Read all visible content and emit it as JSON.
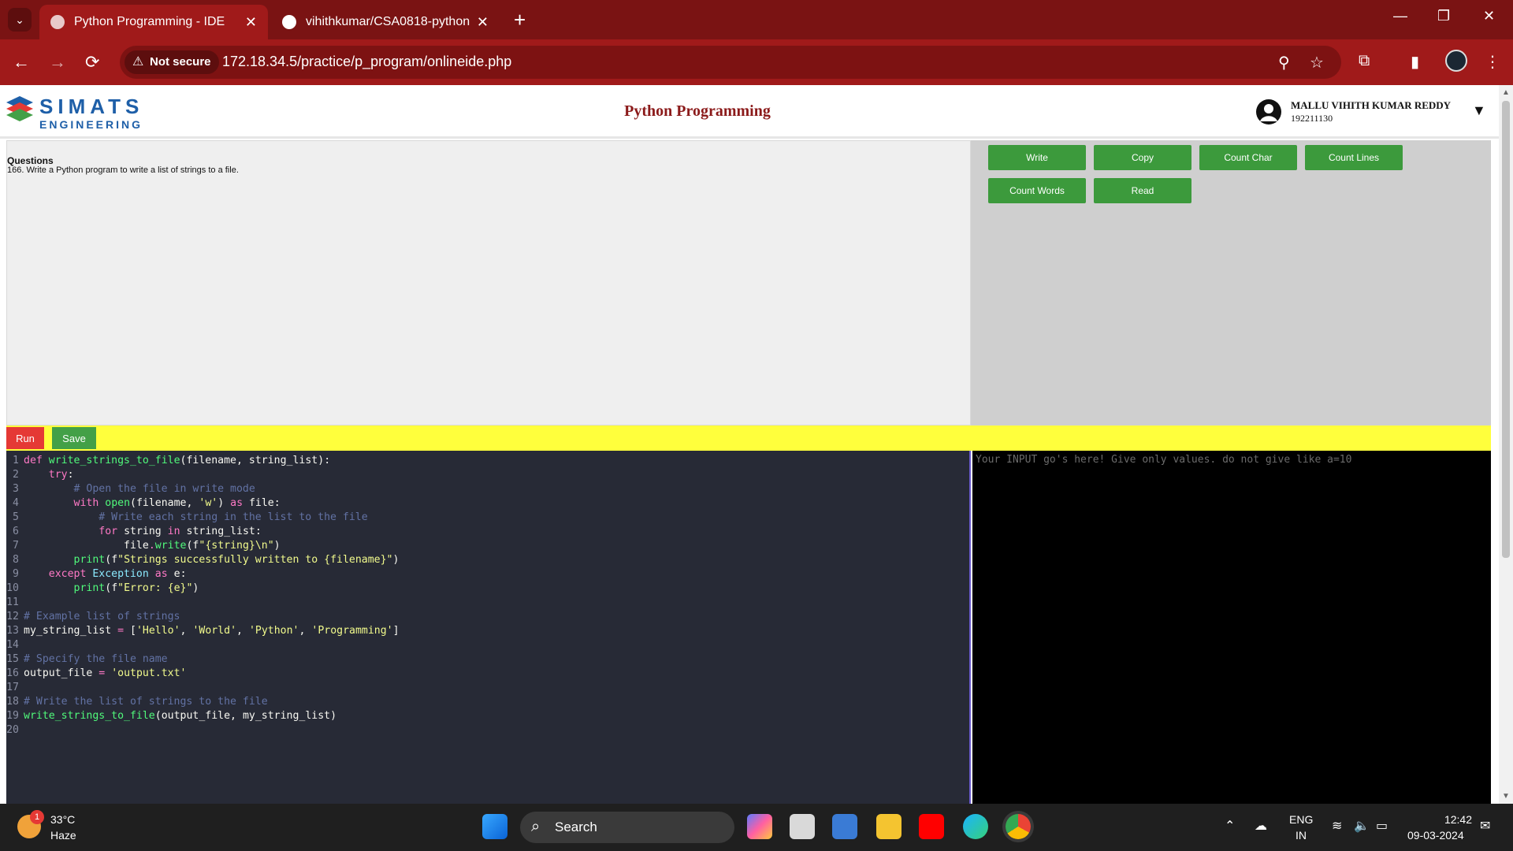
{
  "browser": {
    "tabs": [
      {
        "title": "Python Programming - IDE",
        "active": true
      },
      {
        "title": "vihithkumar/CSA0818-python",
        "active": false
      }
    ],
    "security_label": "Not secure",
    "url": "172.18.34.5/practice/p_program/onlineide.php"
  },
  "header": {
    "logo_text": "SIMATS",
    "logo_sub": "ENGINEERING",
    "title": "Python Programming",
    "user_name": "MALLU VIHITH KUMAR REDDY",
    "user_id": "192211130"
  },
  "question": {
    "heading": "Questions",
    "text": "166. Write a Python program to write a list of strings to a file."
  },
  "tools": {
    "buttons": [
      "Write",
      "Copy",
      "Count Char",
      "Count Lines",
      "Count Words",
      "Read"
    ]
  },
  "actions": {
    "run": "Run",
    "save": "Save"
  },
  "editor": {
    "lines": [
      "def write_strings_to_file(filename, string_list):",
      "    try:",
      "        # Open the file in write mode",
      "        with open(filename, 'w') as file:",
      "            # Write each string in the list to the file",
      "            for string in string_list:",
      "                file.write(f\"{string}\\n\")",
      "        print(f\"Strings successfully written to {filename}\")",
      "    except Exception as e:",
      "        print(f\"Error: {e}\")",
      "",
      "# Example list of strings",
      "my_string_list = ['Hello', 'World', 'Python', 'Programming']",
      "",
      "# Specify the file name",
      "output_file = 'output.txt'",
      "",
      "# Write the list of strings to the file",
      "write_strings_to_file(output_file, my_string_list)",
      ""
    ]
  },
  "input_panel": {
    "placeholder": "Your INPUT go's here! Give only values. do not give like a=10"
  },
  "taskbar": {
    "weather_badge": "1",
    "temperature": "33°C",
    "condition": "Haze",
    "search_label": "Search",
    "lang_line1": "ENG",
    "lang_line2": "IN",
    "time": "12:42",
    "date": "09-03-2024"
  },
  "colors": {
    "chrome_dark": "#7a1313",
    "chrome": "#a01a1a",
    "run": "#e53935",
    "save": "#43a047",
    "tool_button": "#3c9a3c",
    "runbar": "#ffff3c",
    "editor_bg": "#272a36"
  }
}
